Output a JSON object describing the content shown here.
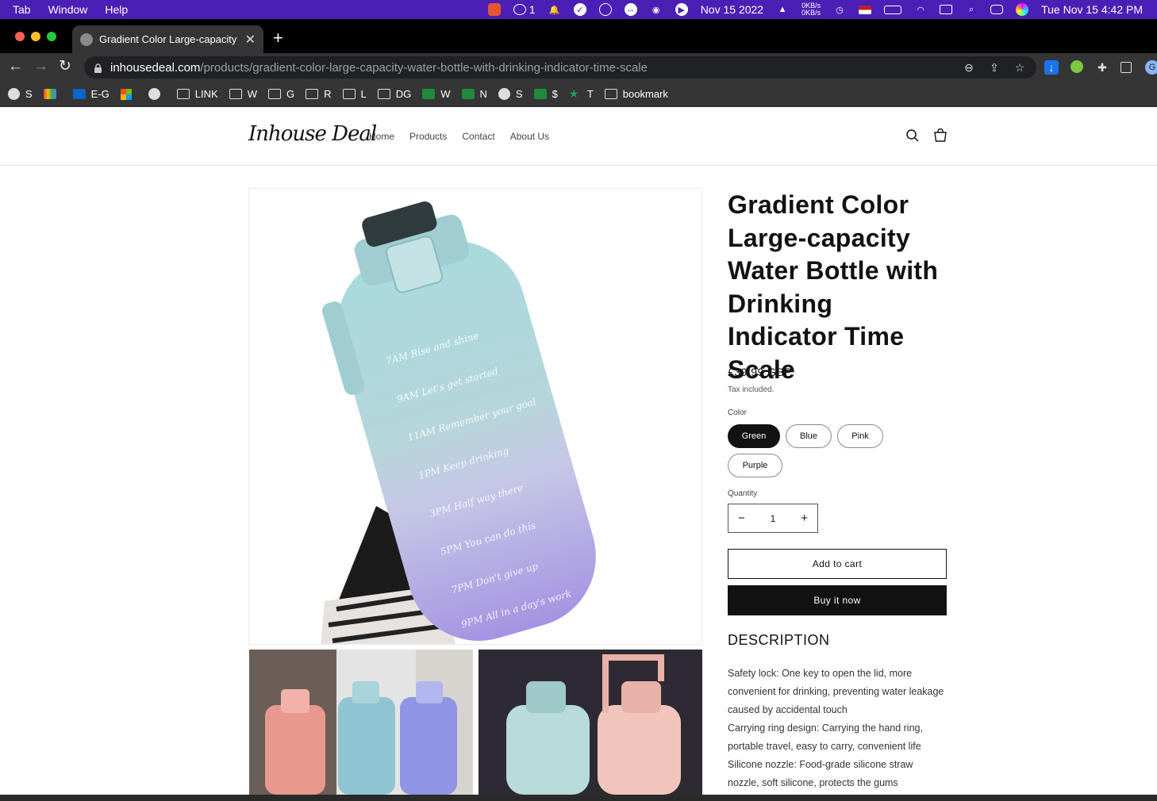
{
  "menubar": {
    "items": [
      "Tab",
      "Window",
      "Help"
    ],
    "wechat_count": "1",
    "date_widget": "Nov 15 2022",
    "net_up": "0KB/s",
    "net_down": "0KB/s",
    "clock": "Tue Nov 15  4:42 PM"
  },
  "browser": {
    "tab_title": "Gradient Color Large-capacity Water Bottle with Drinking Indicator Time Scale",
    "url_host": "inhousedeal.com",
    "url_path": "/products/gradient-color-large-capacity-water-bottle-with-drinking-indicator-time-scale"
  },
  "bookmarks": [
    {
      "label": "S",
      "icon": "globe-icon"
    },
    {
      "label": "",
      "icon": "gmail-icon"
    },
    {
      "label": "E-G",
      "icon": "outlook-icon"
    },
    {
      "label": "",
      "icon": "microsoft-icon"
    },
    {
      "label": "",
      "icon": "globe-icon"
    },
    {
      "label": "LINK",
      "icon": "folder-icon"
    },
    {
      "label": "W",
      "icon": "folder-icon"
    },
    {
      "label": "G",
      "icon": "folder-icon"
    },
    {
      "label": "R",
      "icon": "folder-icon"
    },
    {
      "label": "L",
      "icon": "folder-icon"
    },
    {
      "label": "DG",
      "icon": "folder-icon"
    },
    {
      "label": "W",
      "icon": "sheet-icon"
    },
    {
      "label": "N",
      "icon": "sheet-icon"
    },
    {
      "label": "S",
      "icon": "globe-icon"
    },
    {
      "label": "$",
      "icon": "sheet-icon"
    },
    {
      "label": "T",
      "icon": "star-icon"
    },
    {
      "label": "bookmark",
      "icon": "folder-icon"
    }
  ],
  "store": {
    "logo": "Inhouse Deal",
    "nav": [
      "Home",
      "Products",
      "Contact",
      "About Us"
    ]
  },
  "product": {
    "title": "Gradient Color Large-capacity Water Bottle with Drinking Indicator Time Scale",
    "price": "£39.99 GBP",
    "tax_note": "Tax included.",
    "color_label": "Color",
    "colors": [
      "Green",
      "Blue",
      "Pink",
      "Purple"
    ],
    "selected_color": "Green",
    "quantity_label": "Quantity",
    "quantity": "1",
    "minus": "−",
    "plus": "+",
    "add_to_cart": "Add to cart",
    "buy_now": "Buy it now",
    "description_heading": "DESCRIPTION",
    "description": [
      "Safety lock: One key to open the lid, more convenient for drinking, preventing water leakage caused by accidental touch",
      "Carrying ring design: Carrying the hand ring, portable travel, easy to carry, convenient life",
      "Silicone nozzle: Food-grade silicone straw nozzle, soft silicone, protects the gums"
    ],
    "bottle_markings": [
      {
        "time": "7AM",
        "text": "Rise and shine"
      },
      {
        "time": "9AM",
        "text": "Let's get started"
      },
      {
        "time": "11AM",
        "text": "Remember your goal"
      },
      {
        "time": "1PM",
        "text": "Keep drinking"
      },
      {
        "time": "3PM",
        "text": "Half way there"
      },
      {
        "time": "5PM",
        "text": "You can do this"
      },
      {
        "time": "7PM",
        "text": "Don't give up"
      },
      {
        "time": "9PM",
        "text": "All in a day's work"
      }
    ]
  },
  "colors": {
    "menubar": "#4b1fb5",
    "browser_chrome": "#353535",
    "text_primary": "#121212",
    "bottle_top": "#9fd3d6",
    "bottle_bottom": "#a99be6"
  }
}
